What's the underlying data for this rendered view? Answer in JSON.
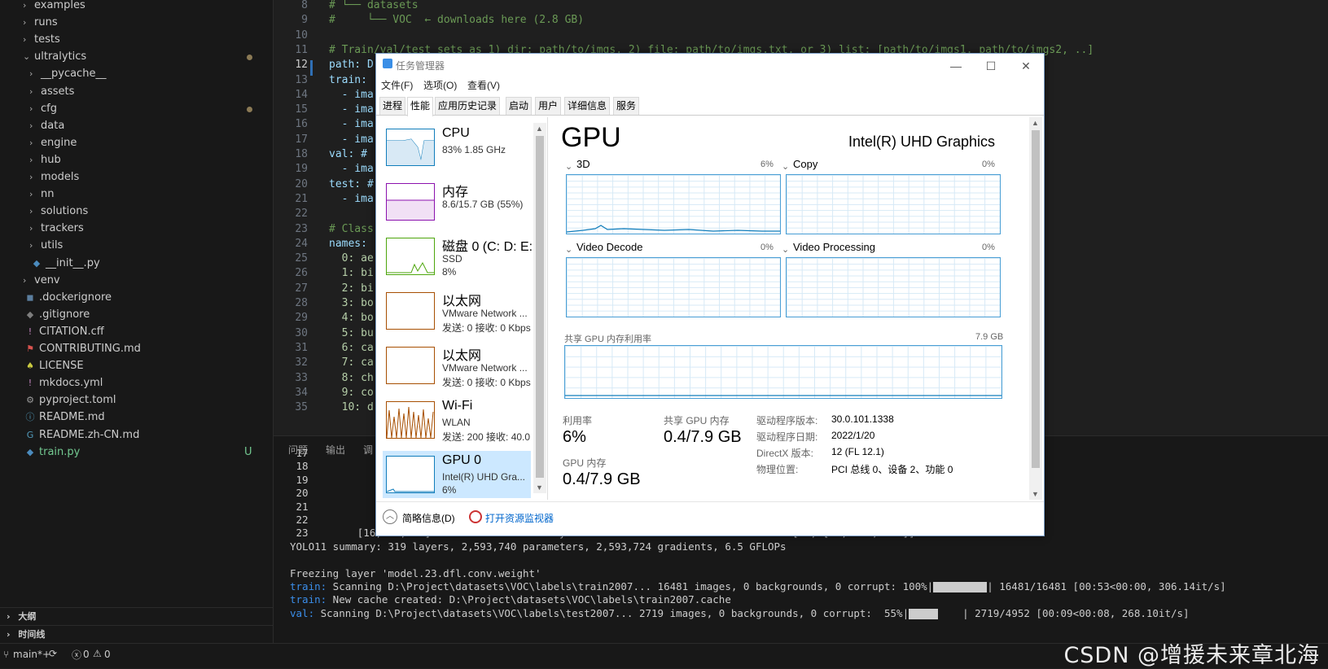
{
  "explorer": {
    "items": [
      {
        "label": "examples",
        "type": "folder"
      },
      {
        "label": "runs",
        "type": "folder"
      },
      {
        "label": "tests",
        "type": "folder"
      },
      {
        "label": "ultralytics",
        "type": "folder-open"
      },
      {
        "label": "__pycache__",
        "type": "folder"
      },
      {
        "label": "assets",
        "type": "folder"
      },
      {
        "label": "cfg",
        "type": "folder"
      },
      {
        "label": "data",
        "type": "folder"
      },
      {
        "label": "engine",
        "type": "folder"
      },
      {
        "label": "hub",
        "type": "folder"
      },
      {
        "label": "models",
        "type": "folder"
      },
      {
        "label": "nn",
        "type": "folder"
      },
      {
        "label": "solutions",
        "type": "folder"
      },
      {
        "label": "trackers",
        "type": "folder"
      },
      {
        "label": "utils",
        "type": "folder"
      },
      {
        "label": "__init__.py",
        "type": "py"
      },
      {
        "label": "venv",
        "type": "folder"
      },
      {
        "label": ".dockerignore",
        "type": "docker"
      },
      {
        "label": ".gitignore",
        "type": "git"
      },
      {
        "label": "CITATION.cff",
        "type": "excl"
      },
      {
        "label": "CONTRIBUTING.md",
        "type": "ribbon"
      },
      {
        "label": "LICENSE",
        "type": "license"
      },
      {
        "label": "mkdocs.yml",
        "type": "excl"
      },
      {
        "label": "pyproject.toml",
        "type": "gear"
      },
      {
        "label": "README.md",
        "type": "info"
      },
      {
        "label": "README.zh-CN.md",
        "type": "g"
      },
      {
        "label": "train.py",
        "type": "py"
      }
    ],
    "git_untracked": "U",
    "outline_label": "大纲",
    "timeline_label": "时间线"
  },
  "editor": {
    "lines": [
      {
        "n": "8",
        "text": "# └── datasets",
        "cls": "comment"
      },
      {
        "n": "9",
        "text": "#     └── VOC  ← downloads here (2.8 GB)",
        "cls": "comment"
      },
      {
        "n": "10",
        "text": "",
        "cls": ""
      },
      {
        "n": "11",
        "text": "# Train/val/test sets as 1) dir: path/to/imgs, 2) file: path/to/imgs.txt, or 3) list: [path/to/imgs1, path/to/imgs2, ..]",
        "cls": "comment"
      },
      {
        "n": "12",
        "text": "path: D",
        "cls": ""
      },
      {
        "n": "13",
        "text": "train:",
        "cls": ""
      },
      {
        "n": "14",
        "text": "  - ima",
        "cls": ""
      },
      {
        "n": "15",
        "text": "  - ima",
        "cls": ""
      },
      {
        "n": "16",
        "text": "  - ima",
        "cls": ""
      },
      {
        "n": "17",
        "text": "  - ima",
        "cls": ""
      },
      {
        "n": "18",
        "text": "val: #",
        "cls": ""
      },
      {
        "n": "19",
        "text": "  - ima",
        "cls": ""
      },
      {
        "n": "20",
        "text": "test: #",
        "cls": ""
      },
      {
        "n": "21",
        "text": "  - ima",
        "cls": ""
      },
      {
        "n": "22",
        "text": "",
        "cls": ""
      },
      {
        "n": "23",
        "text": "# Class",
        "cls": "comment"
      },
      {
        "n": "24",
        "text": "names:",
        "cls": ""
      },
      {
        "n": "25",
        "text": "  0: ae",
        "cls": "num"
      },
      {
        "n": "26",
        "text": "  1: bi",
        "cls": "num"
      },
      {
        "n": "27",
        "text": "  2: bi",
        "cls": "num"
      },
      {
        "n": "28",
        "text": "  3: bo",
        "cls": "num"
      },
      {
        "n": "29",
        "text": "  4: bo",
        "cls": "num"
      },
      {
        "n": "30",
        "text": "  5: bu",
        "cls": "num"
      },
      {
        "n": "31",
        "text": "  6: ca",
        "cls": "num"
      },
      {
        "n": "32",
        "text": "  7: ca",
        "cls": "num"
      },
      {
        "n": "33",
        "text": "  8: ch",
        "cls": "num"
      },
      {
        "n": "34",
        "text": "  9: co",
        "cls": "num"
      },
      {
        "n": "35",
        "text": "  10: d",
        "cls": "num"
      }
    ]
  },
  "panel": {
    "tabs": [
      "问题",
      "输出",
      "调"
    ],
    "terminal_lines": [
      {
        "pre": "",
        "text": " 17"
      },
      {
        "pre": "",
        "text": " 18"
      },
      {
        "pre": "",
        "text": " 19"
      },
      {
        "pre": "",
        "text": " 20"
      },
      {
        "pre": "",
        "text": " 21"
      },
      {
        "pre": "",
        "text": " 22               -1  1    378880  ultralytics.nn.modules.block.C3k2           [384, 256, 1, True]"
      },
      {
        "pre": "",
        "text": " 23        [16, 19, 22]  1    434572  ultralytics.nn.modules.head.Detect          [20, [64, 128, 256]]"
      },
      {
        "pre": "",
        "text": "YOLO11 summary: 319 layers, 2,593,740 parameters, 2,593,724 gradients, 6.5 GFLOPs"
      },
      {
        "pre": "",
        "text": ""
      },
      {
        "pre": "",
        "text": "Freezing layer 'model.23.dfl.conv.weight'"
      }
    ],
    "scan_train": {
      "prefix": "train:",
      "text": " Scanning D:\\Project\\datasets\\VOC\\labels\\train2007... 16481 images, 0 backgrounds, 0 corrupt: 100%|",
      "bar_fraction": 1.0,
      "suffix": "| 16481/16481 [00:53<00:00, 306.14it/s]"
    },
    "cache_line": {
      "prefix": "train:",
      "text": " New cache created: D:\\Project\\datasets\\VOC\\labels\\train2007.cache"
    },
    "scan_val": {
      "prefix": "val:",
      "text": " Scanning D:\\Project\\datasets\\VOC\\labels\\test2007... 2719 images, 0 backgrounds, 0 corrupt:  55%|",
      "bar_fraction": 0.55,
      "suffix": "| 2719/4952 [00:09<00:08, 268.10it/s]"
    }
  },
  "statusbar": {
    "branch": "main*+",
    "errors": "0",
    "warnings": "0",
    "watermark": "CSDN @增援未来章北海"
  },
  "taskmgr": {
    "title": "任务管理器",
    "menu": [
      "文件(F)",
      "选项(O)",
      "查看(V)"
    ],
    "tabs": [
      "进程",
      "性能",
      "应用历史记录",
      "启动",
      "用户",
      "详细信息",
      "服务"
    ],
    "active_tab": "性能",
    "resources": [
      {
        "name": "CPU",
        "sub1": "83% 1.85 GHz",
        "sub2": "",
        "color": "#117dbb"
      },
      {
        "name": "内存",
        "sub1": "8.6/15.7 GB (55%)",
        "sub2": "",
        "color": "#8b12ae"
      },
      {
        "name": "磁盘 0 (C: D: E:",
        "sub1": "SSD",
        "sub2": "8%",
        "color": "#4da60c"
      },
      {
        "name": "以太网",
        "sub1": "VMware Network ...",
        "sub2": "发送: 0 接收: 0 Kbps",
        "color": "#a74f01"
      },
      {
        "name": "以太网",
        "sub1": "VMware Network ...",
        "sub2": "发送: 0 接收: 0 Kbps",
        "color": "#a74f01"
      },
      {
        "name": "Wi-Fi",
        "sub1": "WLAN",
        "sub2": "发送: 200 接收: 40.0",
        "color": "#a74f01"
      },
      {
        "name": "GPU 0",
        "sub1": "Intel(R) UHD Gra...",
        "sub2": "6%",
        "color": "#117dbb"
      }
    ],
    "gpu": {
      "heading": "GPU",
      "model": "Intel(R) UHD Graphics",
      "engines": [
        {
          "label": "3D",
          "pct": "6%"
        },
        {
          "label": "Copy",
          "pct": "0%"
        },
        {
          "label": "Video Decode",
          "pct": "0%"
        },
        {
          "label": "Video Processing",
          "pct": "0%"
        }
      ],
      "shared_label": "共享 GPU 内存利用率",
      "shared_max": "7.9 GB",
      "util_label": "利用率",
      "util_value": "6%",
      "shared_mem_label": "共享 GPU 内存",
      "shared_mem_value": "0.4/7.9 GB",
      "gpu_mem_label": "GPU 内存",
      "gpu_mem_value": "0.4/7.9 GB",
      "details": [
        {
          "k": "驱动程序版本:",
          "v": "30.0.101.1338"
        },
        {
          "k": "驱动程序日期:",
          "v": "2022/1/20"
        },
        {
          "k": "DirectX 版本:",
          "v": "12 (FL 12.1)"
        },
        {
          "k": "物理位置:",
          "v": "PCI 总线 0、设备 2、功能 0"
        }
      ]
    },
    "footer": {
      "summary": "简略信息(D)",
      "monitor": "打开资源监视器"
    }
  }
}
